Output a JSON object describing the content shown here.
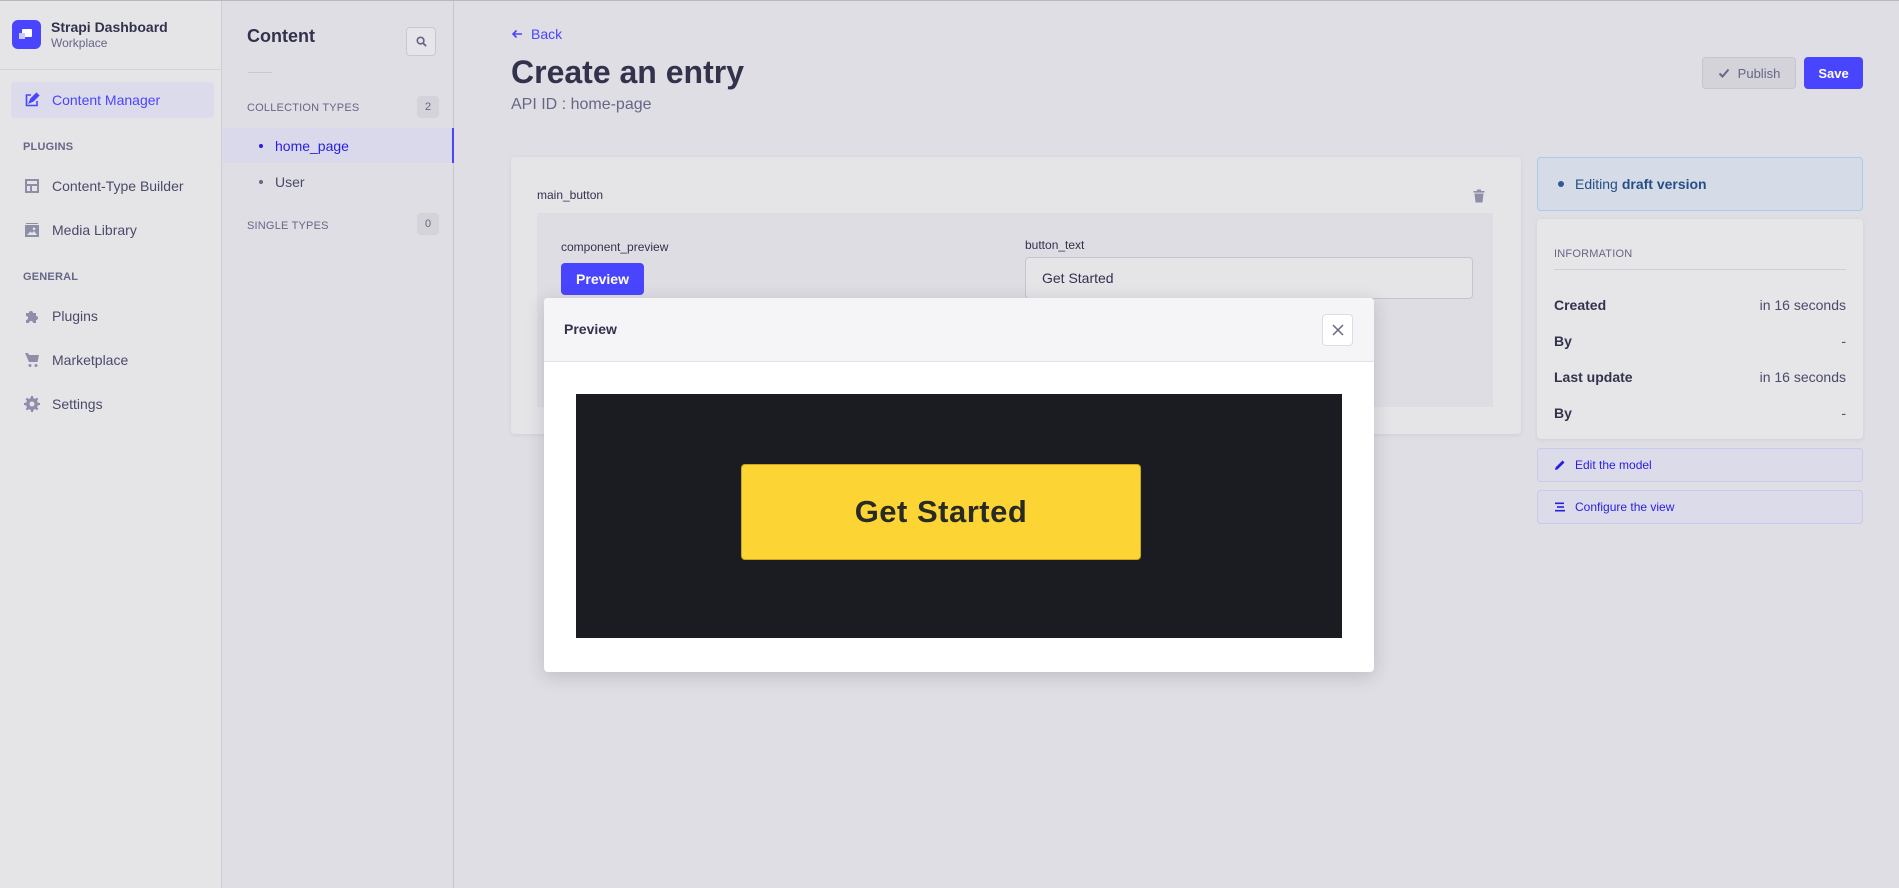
{
  "brand": {
    "title": "Strapi Dashboard",
    "subtitle": "Workplace",
    "accent": "#4945ff"
  },
  "mainnav": {
    "active": {
      "label": "Content Manager",
      "icon": "feather-pen-icon"
    },
    "sections": [
      {
        "title": "PLUGINS",
        "items": [
          {
            "label": "Content-Type Builder",
            "icon": "layout-icon"
          },
          {
            "label": "Media Library",
            "icon": "image-icon"
          }
        ]
      },
      {
        "title": "GENERAL",
        "items": [
          {
            "label": "Plugins",
            "icon": "puzzle-icon"
          },
          {
            "label": "Marketplace",
            "icon": "cart-icon"
          },
          {
            "label": "Settings",
            "icon": "gear-icon"
          }
        ]
      }
    ]
  },
  "subnav": {
    "title": "Content",
    "search_icon": "search-icon",
    "collection_types": {
      "label": "COLLECTION TYPES",
      "count": "2",
      "items": [
        "home_page",
        "User"
      ]
    },
    "single_types": {
      "label": "SINGLE TYPES",
      "count": "0"
    }
  },
  "header": {
    "back_label": "Back",
    "title": "Create an entry",
    "api_id": "API ID : home-page",
    "publish_label": "Publish",
    "save_label": "Save"
  },
  "editor": {
    "component_label": "main_button",
    "preview_field_label": "component_preview",
    "preview_button_label": "Preview",
    "text_field_label": "button_text",
    "text_field_value": "Get Started"
  },
  "sidepanel": {
    "draft_prefix": "Editing",
    "draft_bold": "draft version",
    "info_title": "INFORMATION",
    "rows": [
      {
        "key": "Created",
        "value": "in 16 seconds"
      },
      {
        "key": "By",
        "value": "-"
      },
      {
        "key": "Last update",
        "value": "in 16 seconds"
      },
      {
        "key": "By",
        "value": "-"
      }
    ],
    "edit_model_label": "Edit the model",
    "configure_view_label": "Configure the view"
  },
  "modal": {
    "title": "Preview",
    "preview_button_text": "Get Started",
    "preview_bg": "#1b1c21",
    "preview_button_color": "#fcd535"
  }
}
